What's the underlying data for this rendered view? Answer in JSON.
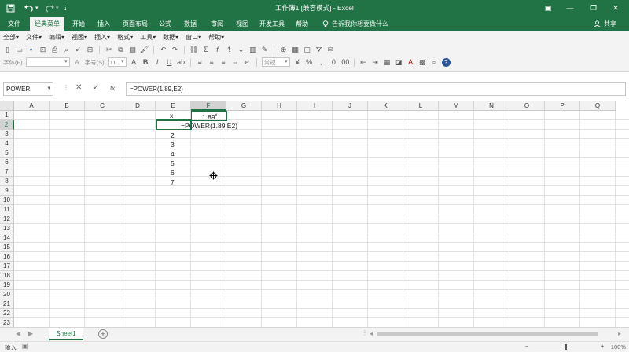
{
  "app": {
    "title": "工作簿1 [兼容模式] - Excel",
    "share_label": "共享",
    "tellme": "告诉我你想要做什么"
  },
  "quick_access": {
    "save_icon": "save-icon",
    "undo_icon": "undo-icon",
    "redo_icon": "redo-icon"
  },
  "tabs": [
    "文件",
    "经典菜单",
    "开始",
    "插入",
    "页面布局",
    "公式",
    "数据",
    "审阅",
    "视图",
    "开发工具",
    "帮助"
  ],
  "active_tab": "经典菜单",
  "classic_menu": [
    "全部▾",
    "文件▾",
    "编辑▾",
    "视图▾",
    "插入▾",
    "格式▾",
    "工具▾",
    "数据▾",
    "窗口▾",
    "帮助▾"
  ],
  "format_bar": {
    "font_label": "字体(F)",
    "size_label": "字号(S)",
    "size_value": "11",
    "style_value": "常规"
  },
  "formula_bar": {
    "name_box": "POWER",
    "formula": "=POWER(1.89,E2)",
    "cancel_glyph": "✕",
    "confirm_glyph": "✓",
    "fx_glyph": "fx"
  },
  "grid": {
    "columns": [
      "A",
      "B",
      "C",
      "D",
      "E",
      "F",
      "G",
      "H",
      "I",
      "J",
      "K",
      "L",
      "M",
      "N",
      "O",
      "P",
      "Q"
    ],
    "rows": [
      "1",
      "2",
      "3",
      "4",
      "5",
      "6",
      "7",
      "8",
      "9",
      "10",
      "11",
      "12",
      "13",
      "14",
      "15",
      "16",
      "17",
      "18",
      "19",
      "20",
      "21",
      "22",
      "23"
    ],
    "selected_column": "F",
    "selected_row": "2",
    "cells": {
      "E1": "x",
      "F1": "1.89",
      "F1_sup": "x",
      "F2": "=POWER(1.89,E2)",
      "E3": "2",
      "E4": "3",
      "E5": "4",
      "E6": "5",
      "E7": "6",
      "E8": "7"
    }
  },
  "sheets": [
    "Sheet1"
  ],
  "status": {
    "mode": "输入",
    "zoom": "100%"
  },
  "colors": {
    "brand": "#217346",
    "ribbon": "#f3f3f3"
  }
}
